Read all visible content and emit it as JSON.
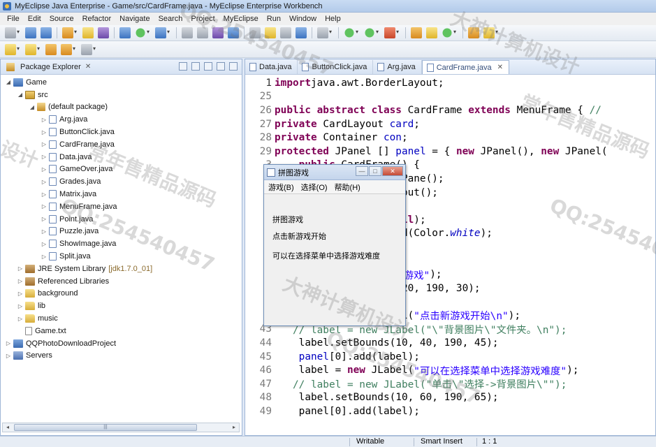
{
  "window": {
    "title": "MyEclipse Java Enterprise - Game/src/CardFrame.java - MyEclipse Enterprise Workbench"
  },
  "menu": [
    "File",
    "Edit",
    "Source",
    "Refactor",
    "Navigate",
    "Search",
    "Project",
    "MyEclipse",
    "Run",
    "Window",
    "Help"
  ],
  "package_explorer": {
    "title": "Package Explorer",
    "close": "✕",
    "tree": [
      {
        "label": "Game",
        "depth": 0,
        "twist": "◢",
        "icon": "project-icon"
      },
      {
        "label": "src",
        "depth": 1,
        "twist": "◢",
        "icon": "source-folder-icon"
      },
      {
        "label": "(default package)",
        "depth": 2,
        "twist": "◢",
        "icon": "package-icon"
      },
      {
        "label": "Arg.java",
        "depth": 3,
        "twist": "▷",
        "icon": "java-file-icon"
      },
      {
        "label": "ButtonClick.java",
        "depth": 3,
        "twist": "▷",
        "icon": "java-file-icon"
      },
      {
        "label": "CardFrame.java",
        "depth": 3,
        "twist": "▷",
        "icon": "java-file-icon"
      },
      {
        "label": "Data.java",
        "depth": 3,
        "twist": "▷",
        "icon": "java-file-icon"
      },
      {
        "label": "GameOver.java",
        "depth": 3,
        "twist": "▷",
        "icon": "java-file-icon"
      },
      {
        "label": "Grades.java",
        "depth": 3,
        "twist": "▷",
        "icon": "java-file-icon"
      },
      {
        "label": "Matrix.java",
        "depth": 3,
        "twist": "▷",
        "icon": "java-file-icon"
      },
      {
        "label": "MenuFrame.java",
        "depth": 3,
        "twist": "▷",
        "icon": "java-file-icon"
      },
      {
        "label": "Point.java",
        "depth": 3,
        "twist": "▷",
        "icon": "java-file-icon"
      },
      {
        "label": "Puzzle.java",
        "depth": 3,
        "twist": "▷",
        "icon": "java-file-icon"
      },
      {
        "label": "ShowImage.java",
        "depth": 3,
        "twist": "▷",
        "icon": "java-file-icon"
      },
      {
        "label": "Split.java",
        "depth": 3,
        "twist": "▷",
        "icon": "java-file-icon"
      },
      {
        "label": "JRE System Library",
        "depth": 1,
        "twist": "▷",
        "icon": "jre-library-icon",
        "extra": "[jdk1.7.0_01]"
      },
      {
        "label": "Referenced Libraries",
        "depth": 1,
        "twist": "▷",
        "icon": "library-icon"
      },
      {
        "label": "background",
        "depth": 1,
        "twist": "▷",
        "icon": "folder-icon"
      },
      {
        "label": "lib",
        "depth": 1,
        "twist": "▷",
        "icon": "folder-icon"
      },
      {
        "label": "music",
        "depth": 1,
        "twist": "▷",
        "icon": "folder-icon"
      },
      {
        "label": "Game.txt",
        "depth": 1,
        "twist": "",
        "icon": "file-icon"
      },
      {
        "label": "QQPhotoDownloadProject",
        "depth": 0,
        "twist": "▷",
        "icon": "project-icon"
      },
      {
        "label": "Servers",
        "depth": 0,
        "twist": "▷",
        "icon": "servers-icon"
      }
    ]
  },
  "editor": {
    "tabs": [
      {
        "label": "Data.java",
        "active": false
      },
      {
        "label": "ButtonClick.java",
        "active": false
      },
      {
        "label": "Arg.java",
        "active": false
      },
      {
        "label": "CardFrame.java",
        "active": true
      }
    ],
    "tab_close": "✕",
    "lines": [
      {
        "n": "1",
        "tokens": [
          [
            "kw",
            "import"
          ],
          [
            "",
            "java.awt.BorderLayout;"
          ]
        ]
      },
      {
        "n": "25",
        "tokens": []
      },
      {
        "n": "26",
        "tokens": [
          [
            "kw",
            "public abstract class"
          ],
          [
            "",
            " CardFrame "
          ],
          [
            "kw",
            "extends"
          ],
          [
            "",
            " MenuFrame { "
          ],
          [
            "cmt",
            "//"
          ]
        ]
      },
      {
        "n": "27",
        "tokens": [
          [
            "kw",
            "private"
          ],
          [
            "",
            " CardLayout "
          ],
          [
            "fld",
            "card"
          ],
          [
            "",
            ";"
          ]
        ]
      },
      {
        "n": "28",
        "tokens": [
          [
            "kw",
            "private"
          ],
          [
            "",
            " Container "
          ],
          [
            "fld",
            "con"
          ],
          [
            "",
            ";"
          ]
        ]
      },
      {
        "n": "29",
        "tokens": [
          [
            "kw",
            "protected"
          ],
          [
            "",
            " JPanel [] "
          ],
          [
            "fld",
            "panel"
          ],
          [
            "",
            " = { "
          ],
          [
            "kw",
            "new"
          ],
          [
            "",
            " JPanel(), "
          ],
          [
            "kw",
            "new"
          ],
          [
            "",
            " JPanel("
          ]
        ]
      },
      {
        "n": "3",
        "tokens": [
          [
            "",
            "    "
          ],
          [
            "kw",
            "public"
          ],
          [
            "",
            " CardFrame() {"
          ]
        ]
      },
      {
        "n": "3",
        "tokens": [
          [
            "",
            "          .getContentPane();"
          ]
        ]
      },
      {
        "n": "3",
        "tokens": [
          [
            "",
            "          "
          ],
          [
            "kw",
            "new"
          ],
          [
            "",
            " CardLayout();"
          ]
        ]
      },
      {
        "n": "3",
        "tokens": [
          [
            "",
            "          yout("
          ],
          [
            "fld",
            "card"
          ],
          [
            "",
            ");"
          ]
        ]
      },
      {
        "n": "3",
        "tokens": [
          [
            "",
            "          etLayout("
          ],
          [
            "kw",
            "null"
          ],
          [
            "",
            ");"
          ]
        ]
      },
      {
        "n": "3",
        "tokens": [
          [
            "",
            "          etBackground(Color."
          ],
          [
            "it",
            "white"
          ],
          [
            "",
            ");"
          ]
        ]
      },
      {
        "n": "3",
        "tokens": []
      },
      {
        "n": "3",
        "tokens": []
      },
      {
        "n": "4",
        "tokens": [
          [
            "",
            "          JLabel("
          ],
          [
            "str",
            "\"拼图游戏\""
          ],
          [
            "",
            ");"
          ]
        ]
      },
      {
        "n": "4",
        "tokens": [
          [
            "",
            "          Bounds(10, 20, 190, 30);"
          ]
        ]
      },
      {
        "n": "4",
        "tokens": [
          [
            "",
            "          d(label);"
          ]
        ]
      },
      {
        "n": "4",
        "tokens": [
          [
            "",
            "    label = "
          ],
          [
            "kw",
            "new"
          ],
          [
            "",
            " JLabel("
          ],
          [
            "str",
            "\"点击新游戏开始\\n\""
          ],
          [
            "",
            ");"
          ]
        ]
      },
      {
        "n": "43",
        "tokens": [
          [
            "cmt",
            "   // label = new JLabel(\"\\\"背景图片\\\"文件夹。\\n\");"
          ]
        ]
      },
      {
        "n": "44",
        "tokens": [
          [
            "",
            "    label.setBounds(10, 40, 190, 45);"
          ]
        ]
      },
      {
        "n": "45",
        "tokens": [
          [
            "",
            "    "
          ],
          [
            "fld",
            "panel"
          ],
          [
            "",
            "[0].add(label);"
          ]
        ]
      },
      {
        "n": "46",
        "tokens": [
          [
            "",
            "    label = "
          ],
          [
            "kw",
            "new"
          ],
          [
            "",
            " JLabel("
          ],
          [
            "str",
            "\"可以在选择菜单中选择游戏难度\""
          ],
          [
            "",
            ");"
          ]
        ]
      },
      {
        "n": "47",
        "tokens": [
          [
            "cmt",
            "   // label = new JLabel(\"单击\\\"选择->背景图片\\\"\");"
          ]
        ]
      },
      {
        "n": "48",
        "tokens": [
          [
            "",
            "    label.setBounds(10, 60, 190, 65);"
          ]
        ]
      },
      {
        "n": "49",
        "tokens": [
          [
            "",
            "    panel[0].add(label);"
          ]
        ]
      }
    ]
  },
  "game_window": {
    "title": "拼图游戏",
    "menu": [
      "游戏(B)",
      "选择(O)",
      "帮助(H)"
    ],
    "labels": [
      "拼图游戏",
      "点击新游戏开始",
      "可以在选择菜单中选择游戏难度"
    ]
  },
  "status": {
    "mode": "Writable",
    "insert": "Smart Insert",
    "position": "1 : 1"
  },
  "watermarks": [
    "QQ:254540457",
    "常年售精品源码",
    "大神计算机设计",
    "设计"
  ]
}
